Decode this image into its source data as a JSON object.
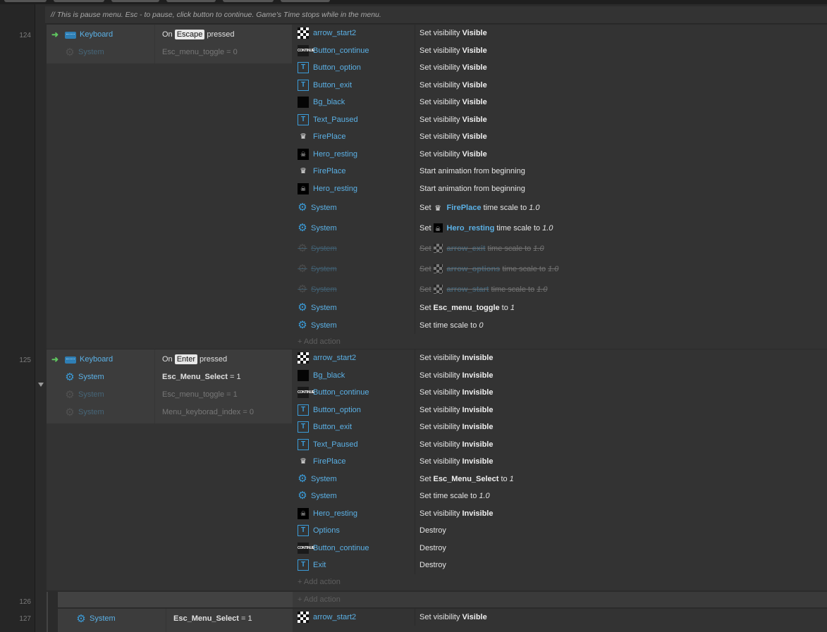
{
  "comment": "//  This is pause menu. Esc - to pause, click button to continue. Game's Time stops while in the menu.",
  "add_action_label": "+ Add action",
  "colors": {
    "object_link": "#5bb1e6",
    "trigger_arrow": "#5fc45f",
    "gear": "#3b9cd9"
  },
  "events": [
    {
      "line": "124",
      "conditions": [
        {
          "icon": "keyboard-icon",
          "object": "Keyboard",
          "pre": "On",
          "key": "Escape",
          "post": "pressed",
          "trigger": true,
          "disabled": false
        },
        {
          "icon": "gear-icon",
          "object": "System",
          "pre": "Esc_menu_toggle = 0",
          "key": "",
          "post": "",
          "trigger": false,
          "disabled": true
        }
      ],
      "actions": [
        {
          "icon": "arrow",
          "object": "arrow_start2",
          "text": "Set visibility",
          "bold": "Visible",
          "disabled": false
        },
        {
          "icon": "button",
          "object": "Button_continue",
          "text": "Set visibility",
          "bold": "Visible",
          "disabled": false
        },
        {
          "icon": "text",
          "object": "Button_option",
          "text": "Set visibility",
          "bold": "Visible",
          "disabled": false
        },
        {
          "icon": "text",
          "object": "Button_exit",
          "text": "Set visibility",
          "bold": "Visible",
          "disabled": false
        },
        {
          "icon": "black",
          "object": "Bg_black",
          "text": "Set visibility",
          "bold": "Visible",
          "disabled": false
        },
        {
          "icon": "text",
          "object": "Text_Paused",
          "text": "Set visibility",
          "bold": "Visible",
          "disabled": false
        },
        {
          "icon": "fire",
          "object": "FirePlace",
          "text": "Set visibility",
          "bold": "Visible",
          "disabled": false
        },
        {
          "icon": "hero",
          "object": "Hero_resting",
          "text": "Set visibility",
          "bold": "Visible",
          "disabled": false
        },
        {
          "icon": "fire",
          "object": "FirePlace",
          "text": "Start animation from beginning",
          "bold": "",
          "disabled": false
        },
        {
          "icon": "hero",
          "object": "Hero_resting",
          "text": "Start animation from beginning",
          "bold": "",
          "disabled": false
        },
        {
          "icon": "gear",
          "object": "System",
          "text": "Set",
          "link_icon": "fire",
          "link": "FirePlace",
          "tail": "time scale to",
          "italic": "1.0",
          "disabled": false,
          "tall": true
        },
        {
          "icon": "gear",
          "object": "System",
          "text": "Set",
          "link_icon": "hero",
          "link": "Hero_resting",
          "tail": "time scale to",
          "italic": "1.0",
          "disabled": false,
          "tall": true
        },
        {
          "icon": "gear",
          "object": "System",
          "text": "Set",
          "link_icon": "arrow",
          "link": "arrow_exit",
          "tail": "time scale to",
          "italic": "1.0",
          "disabled": true,
          "tall": true
        },
        {
          "icon": "gear",
          "object": "System",
          "text": "Set",
          "link_icon": "arrow",
          "link": "arrow_options",
          "tail": "time scale to",
          "italic": "1.0",
          "disabled": true,
          "tall": true
        },
        {
          "icon": "gear",
          "object": "System",
          "text": "Set",
          "link_icon": "arrow",
          "link": "arrow_start",
          "tail": "time scale to",
          "italic": "1.0",
          "disabled": true,
          "tall": true
        },
        {
          "icon": "gear",
          "object": "System",
          "text": "Set",
          "bold": "Esc_menu_toggle",
          "tail": "to",
          "italic": "1",
          "disabled": false
        },
        {
          "icon": "gear",
          "object": "System",
          "text": "Set time scale to",
          "italic": "0",
          "disabled": false
        }
      ]
    },
    {
      "line": "125",
      "conditions": [
        {
          "icon": "keyboard-icon",
          "object": "Keyboard",
          "pre": "On",
          "key": "Enter",
          "post": "pressed",
          "trigger": true,
          "disabled": false
        },
        {
          "icon": "gear-icon",
          "object": "System",
          "boldpre": "Esc_Menu_Select",
          "pre": "= 1",
          "key": "",
          "post": "",
          "trigger": false,
          "disabled": false
        },
        {
          "icon": "gear-icon",
          "object": "System",
          "pre": "Esc_menu_toggle = 1",
          "key": "",
          "post": "",
          "trigger": false,
          "disabled": true
        },
        {
          "icon": "gear-icon",
          "object": "System",
          "pre": "Menu_keyborad_index = 0",
          "key": "",
          "post": "",
          "trigger": false,
          "disabled": true
        }
      ],
      "actions": [
        {
          "icon": "arrow",
          "object": "arrow_start2",
          "text": "Set visibility",
          "bold": "Invisible",
          "disabled": false
        },
        {
          "icon": "black",
          "object": "Bg_black",
          "text": "Set visibility",
          "bold": "Invisible",
          "disabled": false
        },
        {
          "icon": "button",
          "object": "Button_continue",
          "text": "Set visibility",
          "bold": "Invisible",
          "disabled": false
        },
        {
          "icon": "text",
          "object": "Button_option",
          "text": "Set visibility",
          "bold": "Invisible",
          "disabled": false
        },
        {
          "icon": "text",
          "object": "Button_exit",
          "text": "Set visibility",
          "bold": "Invisible",
          "disabled": false
        },
        {
          "icon": "text",
          "object": "Text_Paused",
          "text": "Set visibility",
          "bold": "Invisible",
          "disabled": false
        },
        {
          "icon": "fire",
          "object": "FirePlace",
          "text": "Set visibility",
          "bold": "Invisible",
          "disabled": false
        },
        {
          "icon": "gear",
          "object": "System",
          "text": "Set",
          "bold": "Esc_Menu_Select",
          "tail": "to",
          "italic": "1",
          "disabled": false
        },
        {
          "icon": "gear",
          "object": "System",
          "text": "Set time scale to",
          "italic": "1.0",
          "disabled": false
        },
        {
          "icon": "hero",
          "object": "Hero_resting",
          "text": "Set visibility",
          "bold": "Invisible",
          "disabled": false
        },
        {
          "icon": "text",
          "object": "Options",
          "text": "Destroy",
          "disabled": false
        },
        {
          "icon": "button",
          "object": "Button_continue",
          "text": "Destroy",
          "disabled": false
        },
        {
          "icon": "text",
          "object": "Exit",
          "text": "Destroy",
          "disabled": false
        }
      ]
    }
  ],
  "sub_events": [
    {
      "line": "126"
    },
    {
      "line": "127",
      "object": "System",
      "boldpre": "Esc_Menu_Select",
      "pre": "= 1",
      "action": {
        "icon": "arrow",
        "object": "arrow_start2",
        "text": "Set visibility",
        "bold": "Visible"
      }
    }
  ]
}
